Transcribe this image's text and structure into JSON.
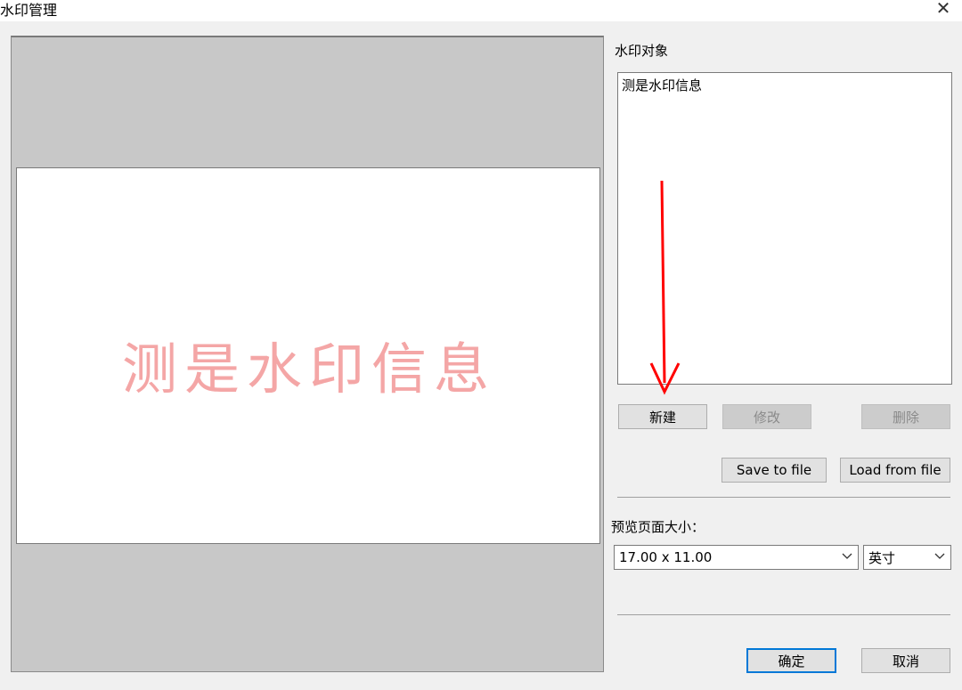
{
  "window": {
    "title": "水印管理"
  },
  "preview": {
    "watermark_text": "测是水印信息"
  },
  "objects": {
    "label": "水印对象",
    "items": [
      "测是水印信息"
    ]
  },
  "buttons": {
    "new": "新建",
    "modify": "修改",
    "delete": "删除",
    "save_to_file": "Save to file",
    "load_from_file": "Load from file",
    "ok": "确定",
    "cancel": "取消"
  },
  "page_size": {
    "label": "预览页面大小：",
    "value": "17.00 x 11.00",
    "unit": "英寸"
  },
  "colors": {
    "watermark": "#f4a6a6",
    "annotation_arrow": "#ff0000",
    "focus_border": "#0078d7"
  },
  "icons": {
    "close": "close-icon",
    "dropdown": "chevron-down-icon",
    "annotation": "red-arrow-annotation"
  }
}
